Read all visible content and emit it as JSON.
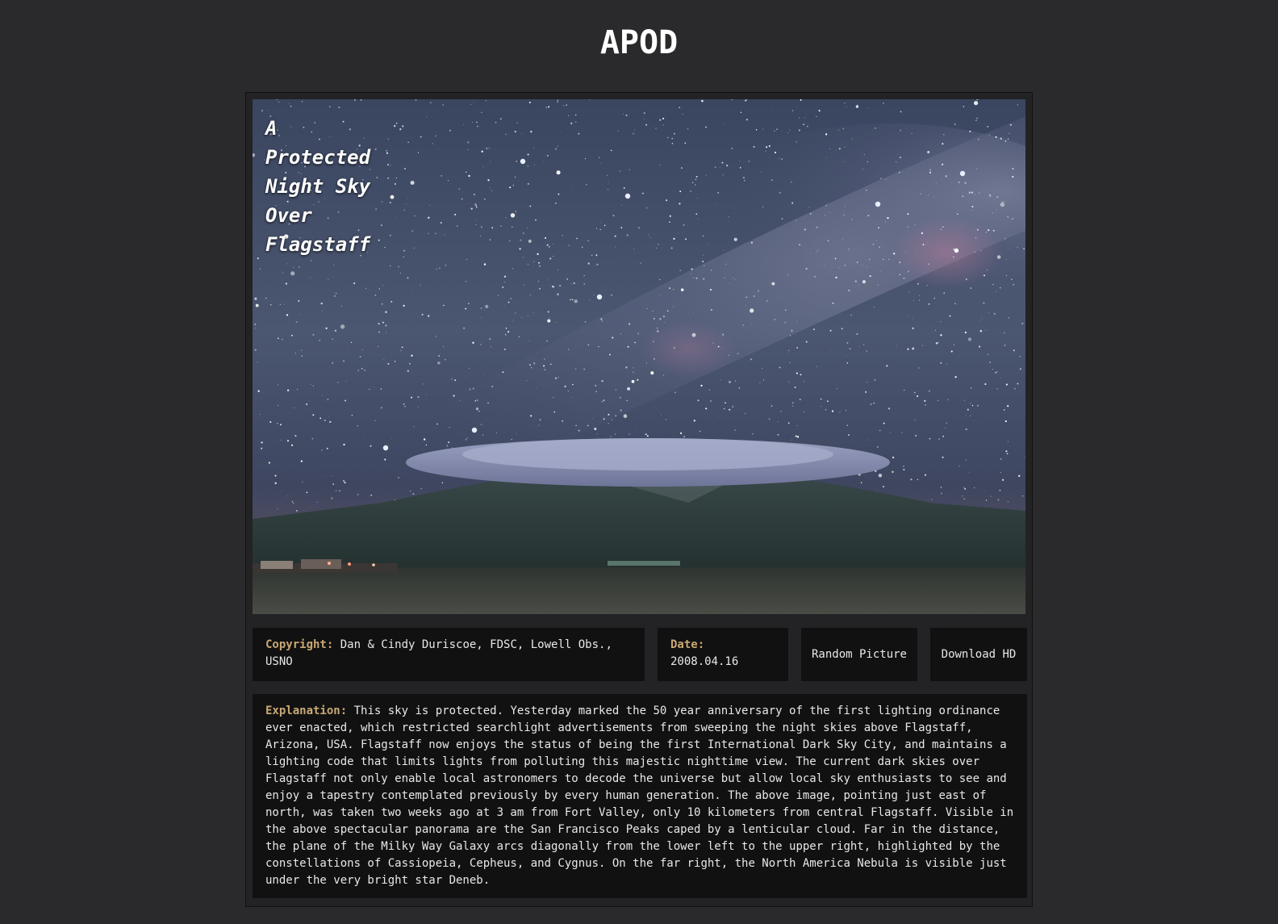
{
  "site": {
    "title": "APOD"
  },
  "photo": {
    "title": "A Protected Night Sky Over Flagstaff"
  },
  "info": {
    "copyright_label": "Copyright:",
    "copyright_value": "Dan & Cindy Duriscoe, FDSC, Lowell Obs., USNO",
    "date_label": "Date:",
    "date_value": "2008.04.16"
  },
  "actions": {
    "random_label": "Random Picture",
    "download_label": "Download HD"
  },
  "explanation": {
    "label": "Explanation:",
    "text": "This sky is protected. Yesterday marked the 50 year anniversary of the first lighting ordinance ever enacted, which restricted searchlight advertisements from sweeping the night skies above Flagstaff, Arizona, USA. Flagstaff now enjoys the status of being the first International Dark Sky City, and maintains a lighting code that limits lights from polluting this majestic nighttime view. The current dark skies over Flagstaff not only enable local astronomers to decode the universe but allow local sky enthusiasts to see and enjoy a tapestry contemplated previously by every human generation. The above image, pointing just east of north, was taken two weeks ago at 3 am from Fort Valley, only 10 kilometers from central Flagstaff. Visible in the above spectacular panorama are the San Francisco Peaks caped by a lenticular cloud. Far in the distance, the plane of the Milky Way Galaxy arcs diagonally from the lower left to the upper right, highlighted by the constellations of Cassiopeia, Cepheus, and Cygnus. On the far right, the North America Nebula is visible just under the very bright star Deneb."
  },
  "colors": {
    "background": "#2a2a2c",
    "card": "#111111",
    "label_accent": "#c9a874"
  }
}
